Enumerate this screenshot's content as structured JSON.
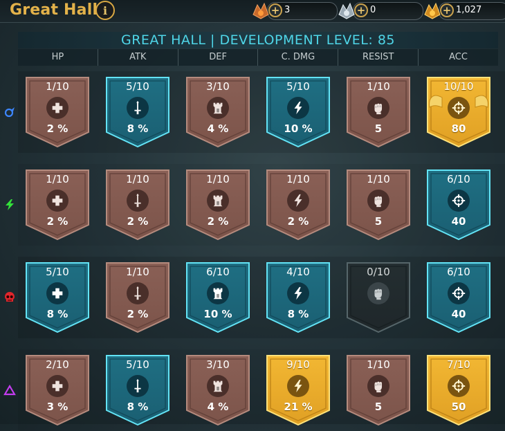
{
  "header": {
    "title": "Great Hall",
    "info_label": "i",
    "resources": [
      {
        "icon": "bronze-emblem-icon",
        "value": "3"
      },
      {
        "icon": "silver-emblem-icon",
        "value": "0"
      },
      {
        "icon": "gold-emblem-icon",
        "value": "1,027"
      }
    ]
  },
  "panel": {
    "title": "GREAT HALL | DEVELOPMENT LEVEL: 85",
    "columns": [
      "HP",
      "ATK",
      "DEF",
      "C. DMG",
      "RESIST",
      "ACC"
    ]
  },
  "colors": {
    "bronze": "#8a6056",
    "blue": "#1f6f83",
    "gold": "#f2b733",
    "grey": "#2a3436",
    "accent": "#4fd6e8"
  },
  "rows": [
    {
      "affinity": "magic-affinity-icon",
      "cells": [
        {
          "level": "1/10",
          "value": "2 %",
          "tier": "bronze",
          "icon": "hp-cross-icon"
        },
        {
          "level": "5/10",
          "value": "8 %",
          "tier": "blue",
          "icon": "atk-sword-icon"
        },
        {
          "level": "3/10",
          "value": "4 %",
          "tier": "bronze",
          "icon": "def-tower-icon"
        },
        {
          "level": "5/10",
          "value": "10 %",
          "tier": "blue",
          "icon": "crit-dmg-bolt-icon"
        },
        {
          "level": "1/10",
          "value": "5",
          "tier": "bronze",
          "icon": "resist-fist-icon"
        },
        {
          "level": "10/10",
          "value": "80",
          "tier": "gold-max",
          "icon": "acc-crosshair-icon"
        }
      ]
    },
    {
      "affinity": "force-affinity-icon",
      "cells": [
        {
          "level": "1/10",
          "value": "2 %",
          "tier": "bronze",
          "icon": "hp-cross-icon"
        },
        {
          "level": "1/10",
          "value": "2 %",
          "tier": "bronze",
          "icon": "atk-sword-icon"
        },
        {
          "level": "1/10",
          "value": "2 %",
          "tier": "bronze",
          "icon": "def-tower-icon"
        },
        {
          "level": "1/10",
          "value": "2 %",
          "tier": "bronze",
          "icon": "crit-dmg-bolt-icon"
        },
        {
          "level": "1/10",
          "value": "5",
          "tier": "bronze",
          "icon": "resist-fist-icon"
        },
        {
          "level": "6/10",
          "value": "40",
          "tier": "blue",
          "icon": "acc-crosshair-icon"
        }
      ]
    },
    {
      "affinity": "spirit-affinity-icon",
      "cells": [
        {
          "level": "5/10",
          "value": "8 %",
          "tier": "blue",
          "icon": "hp-cross-icon"
        },
        {
          "level": "1/10",
          "value": "2 %",
          "tier": "bronze",
          "icon": "atk-sword-icon"
        },
        {
          "level": "6/10",
          "value": "10 %",
          "tier": "blue",
          "icon": "def-tower-icon"
        },
        {
          "level": "4/10",
          "value": "8 %",
          "tier": "blue",
          "icon": "crit-dmg-bolt-icon"
        },
        {
          "level": "0/10",
          "value": "",
          "tier": "grey",
          "icon": "resist-fist-icon"
        },
        {
          "level": "6/10",
          "value": "40",
          "tier": "blue",
          "icon": "acc-crosshair-icon"
        }
      ]
    },
    {
      "affinity": "void-affinity-icon",
      "cells": [
        {
          "level": "2/10",
          "value": "3 %",
          "tier": "bronze",
          "icon": "hp-cross-icon"
        },
        {
          "level": "5/10",
          "value": "8 %",
          "tier": "blue",
          "icon": "atk-sword-icon"
        },
        {
          "level": "3/10",
          "value": "4 %",
          "tier": "bronze",
          "icon": "def-tower-icon"
        },
        {
          "level": "9/10",
          "value": "21 %",
          "tier": "gold",
          "icon": "crit-dmg-bolt-icon"
        },
        {
          "level": "1/10",
          "value": "5",
          "tier": "bronze",
          "icon": "resist-fist-icon"
        },
        {
          "level": "7/10",
          "value": "50",
          "tier": "gold",
          "icon": "acc-crosshair-icon"
        }
      ]
    }
  ]
}
